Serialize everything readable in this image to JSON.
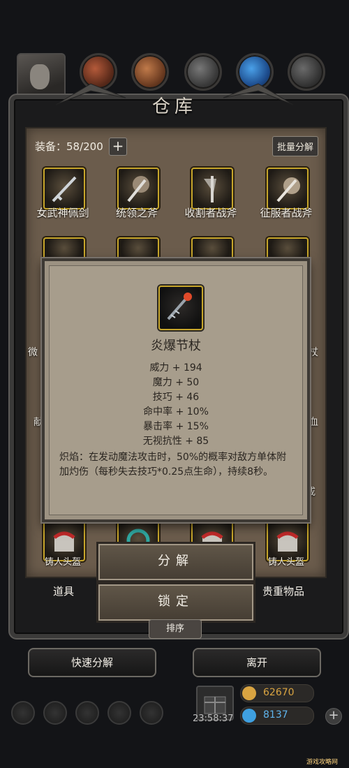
{
  "title": "仓库",
  "equip": {
    "label": "装备：58/200",
    "add": "+",
    "bulk": "批量分解"
  },
  "items_top": [
    "女武神佩剑",
    "统领之斧",
    "收割者战斧",
    "征服者战斧"
  ],
  "partial_labels": {
    "left1": "微",
    "right1": "杖",
    "left2": "献",
    "right2": "血",
    "right3": "戒",
    "bottom1": "铸人头盔",
    "bottom4": "铸人头盔"
  },
  "tooltip": {
    "name": "炎爆节杖",
    "stats": [
      "威力 + 194",
      "魔力 + 50",
      "技巧 + 46",
      "命中率 + 10%",
      "暴击率 + 15%",
      "无视抗性 + 85"
    ],
    "desc": "炽焰：在发动魔法攻击时，50%的概率对敌方单体附加灼伤（每秒失去技巧*0.25点生命），持续8秒。"
  },
  "actions": {
    "decompose": "分解",
    "lock": "锁定"
  },
  "tabs": {
    "props": "道具",
    "valuables": "贵重物品",
    "sort": "排序"
  },
  "buttons": {
    "quick": "快速分解",
    "leave": "离开"
  },
  "footer": {
    "timer": "23:58:37",
    "gold": "62670",
    "gem": "8137",
    "plus": "+",
    "watermark": "游戏攻略网"
  },
  "colors": {
    "frame": "#3b3a39",
    "panel": "#6b5c4c",
    "tooltip": "#a79d8c",
    "slot_border": "#c6a52a",
    "gold": "#d9a441",
    "gem": "#3fa0e0"
  },
  "icons": [
    "portrait-icon",
    "sword-icon",
    "axe-icon",
    "battleaxe-icon",
    "staff-icon",
    "helmet-icon",
    "giftbox-icon",
    "coin-icon",
    "gem-icon"
  ]
}
